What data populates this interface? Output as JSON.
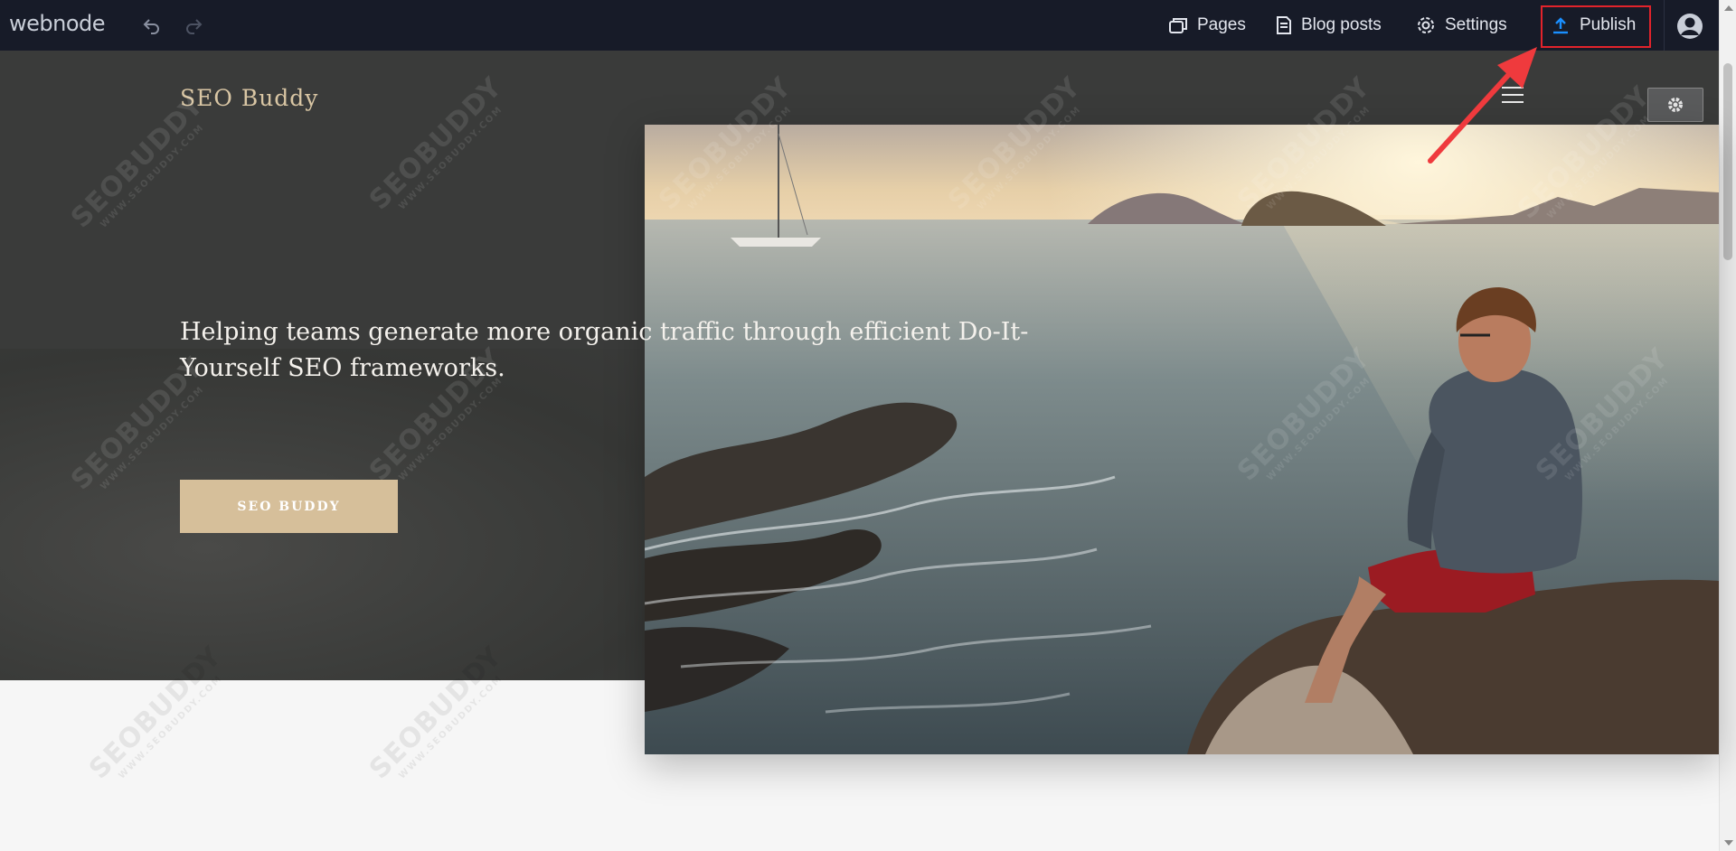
{
  "toolbar": {
    "logo": "webnode",
    "pages": "Pages",
    "blog_posts": "Blog posts",
    "settings": "Settings",
    "publish": "Publish"
  },
  "site": {
    "title": "SEO Buddy",
    "tagline": "Helping teams generate more organic traffic through efficient Do-It-Yourself SEO frameworks.",
    "cta": "SEO BUDDY"
  },
  "watermark": {
    "brand": "SEOBUDDY",
    "url": "WWW.SEOBUDDY.COM"
  },
  "colors": {
    "toolbar_bg": "#171b28",
    "accent_publish": "#1a8fff",
    "highlight_box": "#e2232b",
    "cta_bg": "#d6bf9a",
    "title_color": "#d9c6a4"
  }
}
